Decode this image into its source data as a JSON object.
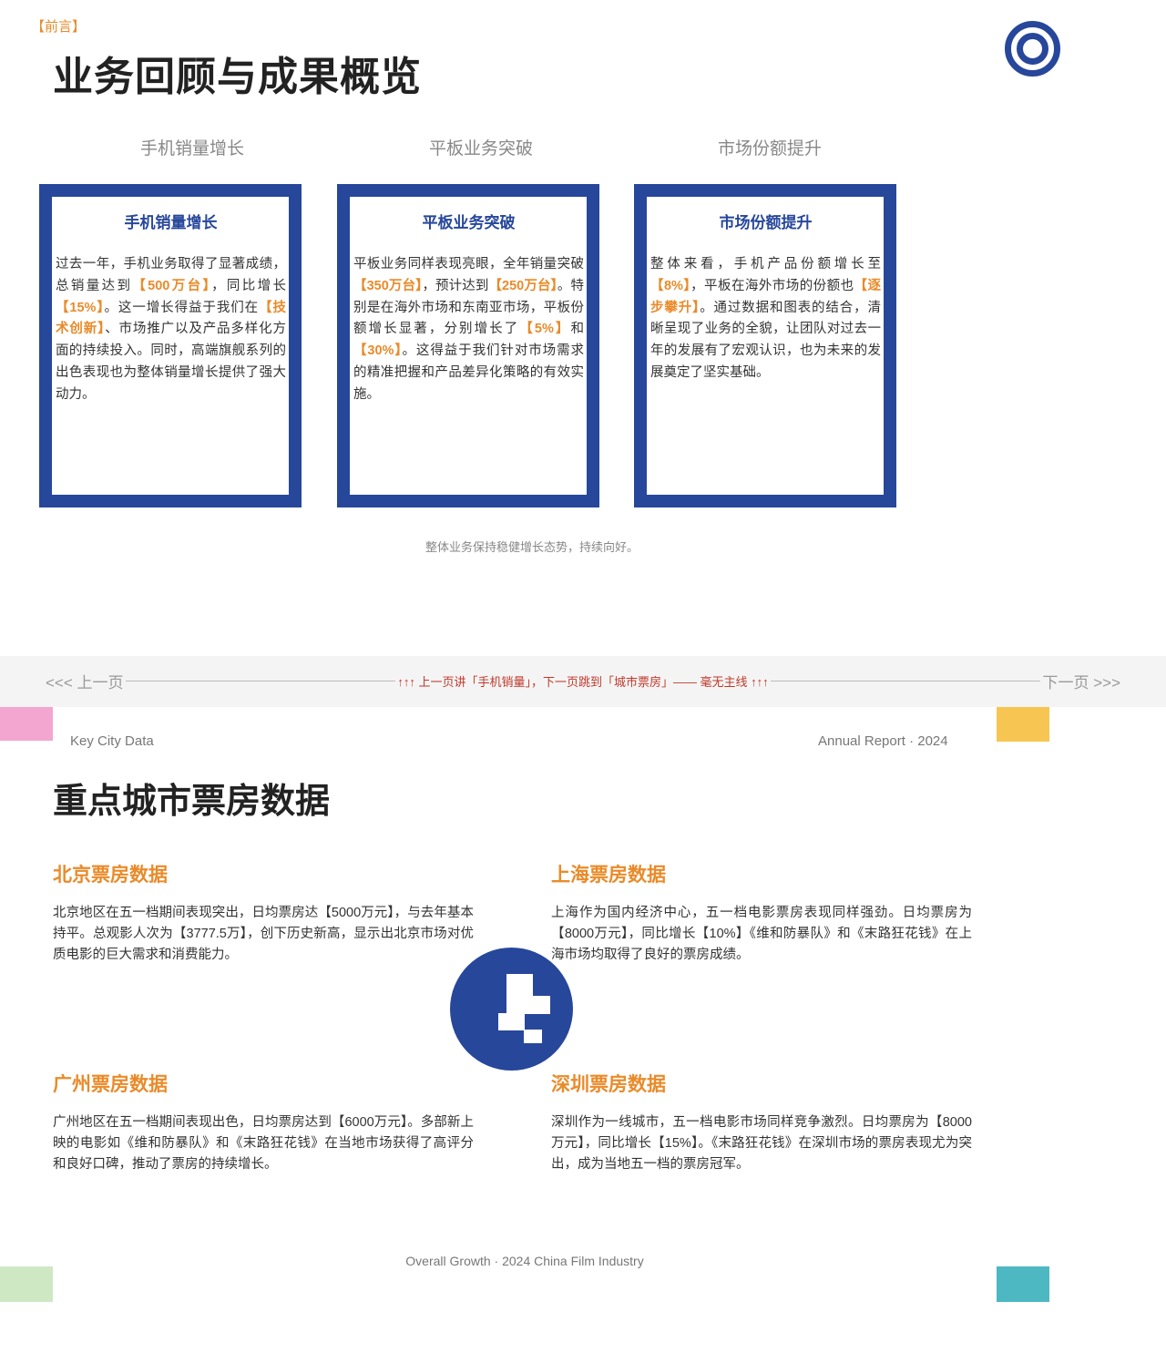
{
  "slide1": {
    "tag": "【前言】",
    "title": "业务回顾与成果概览",
    "columns": [
      {
        "heading": "手机销量增长",
        "card_title": "手机销量增长",
        "segments": [
          {
            "t": "过去一年，手机业务取得了显著成绩，总销量达到",
            "h": false
          },
          {
            "t": "【500万台】",
            "h": true
          },
          {
            "t": "，同比增长",
            "h": false
          },
          {
            "t": "【15%】",
            "h": true
          },
          {
            "t": "。这一增长得益于我们在",
            "h": false
          },
          {
            "t": "【技术创新】",
            "h": true
          },
          {
            "t": "、市场推广以及产品多样化方面的持续投入。同时，高端旗舰系列的出色表现也为整体销量增长提供了强大动力。",
            "h": false
          }
        ]
      },
      {
        "heading": "平板业务突破",
        "card_title": "平板业务突破",
        "segments": [
          {
            "t": "平板业务同样表现亮眼，全年销量突破",
            "h": false
          },
          {
            "t": "【350万台】",
            "h": true
          },
          {
            "t": "，预计达到",
            "h": false
          },
          {
            "t": "【250万台】",
            "h": true
          },
          {
            "t": "。特别是在海外市场和东南亚市场，平板份额增长显著，分别增长了",
            "h": false
          },
          {
            "t": "【5%】",
            "h": true
          },
          {
            "t": "和",
            "h": false
          },
          {
            "t": "【30%】",
            "h": true
          },
          {
            "t": "。这得益于我们针对市场需求的精准把握和产品差异化策略的有效实施。",
            "h": false
          }
        ]
      },
      {
        "heading": "市场份额提升",
        "card_title": "市场份额提升",
        "segments": [
          {
            "t": "整体来看，手机产品份额增长至",
            "h": false
          },
          {
            "t": "【8%】",
            "h": true
          },
          {
            "t": "，平板在海外市场的份额也",
            "h": false
          },
          {
            "t": "【逐步攀升】",
            "h": true
          },
          {
            "t": "。通过数据和图表的结合，清晰呈现了业务的全貌，让团队对过去一年的发展有了宏观认识，也为未来的发展奠定了坚实基础。",
            "h": false
          }
        ]
      }
    ],
    "footnote": "整体业务保持稳健增长态势，持续向好。"
  },
  "divider": {
    "prev_label": "<<< 上一页",
    "next_label": "下一页 >>>",
    "note": "↑↑↑ 上一页讲「手机销量」，下一页跳到「城市票房」—— 毫无主线 ↑↑↑"
  },
  "slide2": {
    "eyebrow_left": "Key City Data",
    "eyebrow_right": "Annual Report · 2024",
    "title": "重点城市票房数据",
    "cities": [
      {
        "heading": "北京票房数据",
        "body": "北京地区在五一档期间表现突出，日均票房达【5000万元】，与去年基本持平。总观影人次为【3777.5万】，创下历史新高，显示出北京市场对优质电影的巨大需求和消费能力。"
      },
      {
        "heading": "上海票房数据",
        "body": "上海作为国内经济中心，五一档电影票房表现同样强劲。日均票房为【8000万元】，同比增长【10%】《维和防暴队》和《末路狂花钱》在上海市场均取得了良好的票房成绩。"
      },
      {
        "heading": "广州票房数据",
        "body": "广州地区在五一档期间表现出色，日均票房达到【6000万元】。多部新上映的电影如《维和防暴队》和《末路狂花钱》在当地市场获得了高评分和良好口碑，推动了票房的持续增长。"
      },
      {
        "heading": "深圳票房数据",
        "body": "深圳作为一线城市，五一档电影市场同样竞争激烈。日均票房为【8000万元】，同比增长【15%】。《末路狂花钱》在深圳市场的票房表现尤为突出，成为当地五一档的票房冠军。"
      }
    ],
    "footer": "Overall Growth · 2024 China Film Industry"
  },
  "colors": {
    "primary_blue": "#27479b",
    "accent_orange": "#e98b2a",
    "corner_pink": "#f3a6cf",
    "corner_yellow": "#f7c652",
    "corner_green": "#cfe8c4",
    "corner_teal": "#4db8c2",
    "nav_red": "#c0392b"
  }
}
